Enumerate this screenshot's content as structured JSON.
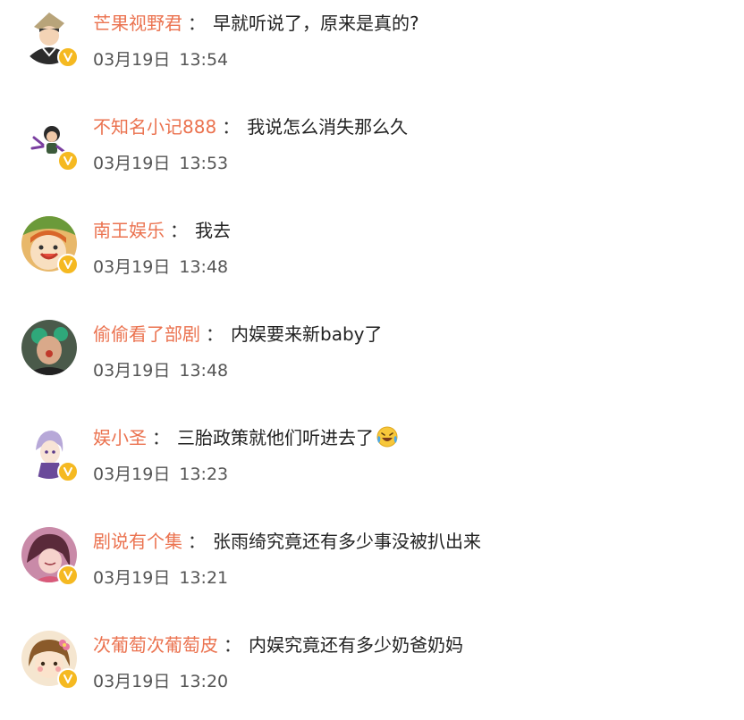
{
  "comments": [
    {
      "username": "芒果视野君",
      "separator": "：",
      "text": "早就听说了，原来是真的?",
      "date": "03月19日",
      "time": "13:54",
      "avatar": "cartoon-boy-hat-avatar",
      "verified": true
    },
    {
      "username": "不知名小记888",
      "separator": "：",
      "text": "我说怎么消失那么久",
      "date": "03月19日",
      "time": "13:53",
      "avatar": "chibi-figure-avatar",
      "verified": true
    },
    {
      "username": "南王娱乐",
      "separator": "：",
      "text": "我去",
      "date": "03月19日",
      "time": "13:48",
      "avatar": "orange-anime-face-avatar",
      "verified": true
    },
    {
      "username": "偷偷看了部剧",
      "separator": "：",
      "text": "内娱要来新baby了",
      "date": "03月19日",
      "time": "13:48",
      "avatar": "photo-portrait-avatar",
      "verified": false
    },
    {
      "username": "娱小圣",
      "separator": "：",
      "text": "三胎政策就他们听进去了",
      "emoji": "laughing-tears-emoji",
      "date": "03月19日",
      "time": "13:23",
      "avatar": "anime-purple-hair-avatar",
      "verified": true
    },
    {
      "username": "剧说有个集",
      "separator": "：",
      "text": "张雨绮究竟还有多少事没被扒出来",
      "date": "03月19日",
      "time": "13:21",
      "avatar": "anime-girl-pink-avatar",
      "verified": true
    },
    {
      "username": "次葡萄次葡萄皮",
      "separator": "：",
      "text": "内娱究竟还有多少奶爸奶妈",
      "date": "03月19日",
      "time": "13:20",
      "avatar": "cute-girl-flower-avatar",
      "verified": true
    }
  ],
  "colors": {
    "username": "#eb7350",
    "verified_badge": "#f5b921",
    "timestamp": "#555555"
  }
}
